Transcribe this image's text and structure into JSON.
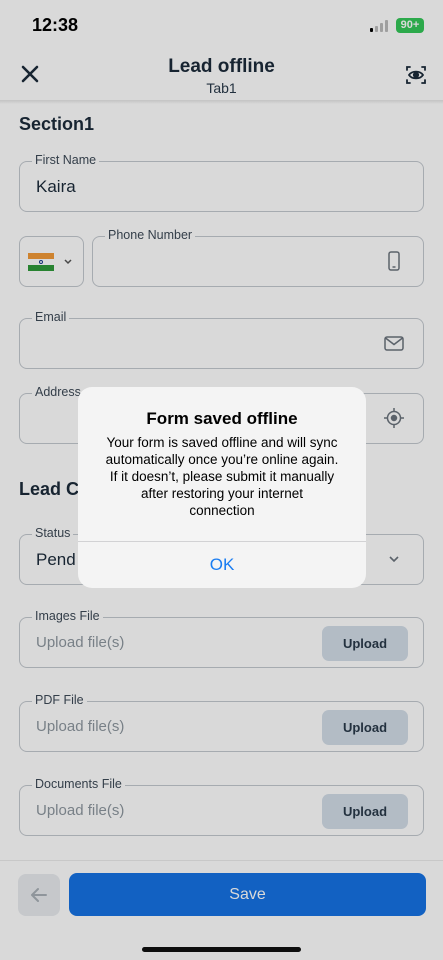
{
  "status_bar": {
    "time": "12:38",
    "battery": "90+"
  },
  "header": {
    "title": "Lead offline",
    "subtitle": "Tab1"
  },
  "section1": {
    "title": "Section1"
  },
  "fields": {
    "first_name": {
      "label": "First Name",
      "value": "Kaira"
    },
    "phone": {
      "label": "Phone Number",
      "value": ""
    },
    "email": {
      "label": "Email",
      "value": ""
    },
    "address": {
      "label": "Address",
      "value": ""
    },
    "status": {
      "label": "Status",
      "value": "Pend"
    }
  },
  "section2": {
    "title": "Lead C"
  },
  "uploads": [
    {
      "label": "Images File",
      "placeholder": "Upload file(s)",
      "button": "Upload"
    },
    {
      "label": "PDF File",
      "placeholder": "Upload file(s)",
      "button": "Upload"
    },
    {
      "label": "Documents File",
      "placeholder": "Upload file(s)",
      "button": "Upload"
    }
  ],
  "footer": {
    "save_label": "Save"
  },
  "dialog": {
    "title": "Form saved offline",
    "lines": [
      "Your form is saved offline and will sync",
      "automatically once you’re online again.",
      "If it doesn’t, please submit it manually",
      "after restoring your internet",
      "connection"
    ],
    "ok_label": "OK"
  },
  "colors": {
    "accent": "#1673e4",
    "dialog_link": "#1a7df2",
    "battery": "#34c759"
  },
  "icons": [
    "close-icon",
    "eye-scan-icon",
    "phone-icon",
    "mail-icon",
    "location-target-icon",
    "chevron-down-icon",
    "arrow-left-icon"
  ]
}
